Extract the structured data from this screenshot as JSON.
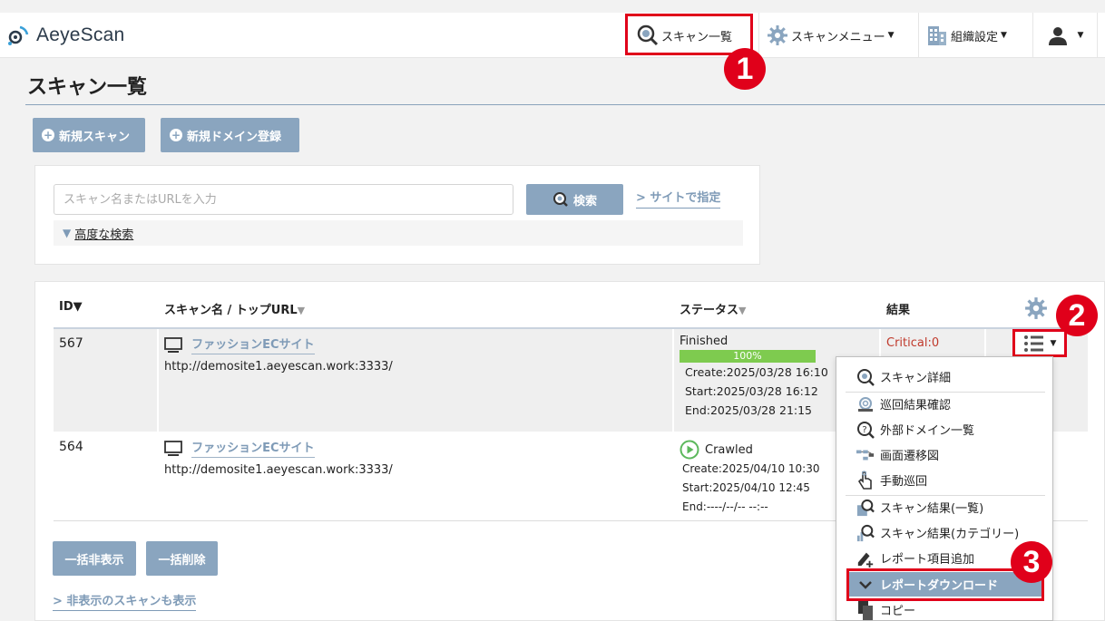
{
  "app": {
    "logo_text": "AeyeScan"
  },
  "nav": {
    "scan_list": "スキャン一覧",
    "scan_menu": "スキャンメニュー",
    "org_settings": "組織設定"
  },
  "markers": {
    "one": "1",
    "two": "2",
    "three": "3"
  },
  "page": {
    "title": "スキャン一覧"
  },
  "actions": {
    "new_scan": "新規スキャン",
    "new_domain": "新規ドメイン登録"
  },
  "search": {
    "placeholder": "スキャン名またはURLを入力",
    "button": "検索",
    "site_link": "サイトで指定",
    "advanced": "高度な検索"
  },
  "table": {
    "headers": {
      "id": "ID▼",
      "name": "スキャン名 / トップURL",
      "status": "ステータス",
      "result": "結果"
    },
    "rows": [
      {
        "id": "567",
        "name": "ファッションECサイト",
        "url": "http://demosite1.aeyescan.work:3333/",
        "status": "Finished",
        "progress_label": "100%",
        "progress": 1.0,
        "create": "Create:2025/03/28 16:10",
        "start": "Start:2025/03/28 16:12",
        "end": "End:2025/03/28 21:15",
        "result": "Critical:0"
      },
      {
        "id": "564",
        "name": "ファッションECサイト",
        "url": "http://demosite1.aeyescan.work:3333/",
        "status": "Crawled",
        "create": "Create:2025/04/10 10:30",
        "start": "Start:2025/04/10 12:45",
        "end": "End:----/--/-- --:--"
      }
    ]
  },
  "bulk": {
    "hide": "一括非表示",
    "delete": "一括削除",
    "show_hidden": "非表示のスキャンも表示"
  },
  "menu": {
    "items": [
      {
        "label": "スキャン詳細",
        "icon": "magnifier-icon"
      },
      {
        "label": "巡回結果確認",
        "icon": "snail-icon"
      },
      {
        "label": "外部ドメイン一覧",
        "icon": "question-magnifier-icon"
      },
      {
        "label": "画面遷移図",
        "icon": "flow-diagram-icon"
      },
      {
        "label": "手動巡回",
        "icon": "hand-pointer-icon"
      },
      {
        "label": "スキャン結果(一覧)",
        "icon": "result-list-icon"
      },
      {
        "label": "スキャン結果(カテゴリー)",
        "icon": "result-category-icon"
      },
      {
        "label": "レポート項目追加",
        "icon": "pen-plus-icon"
      },
      {
        "label": "レポートダウンロード",
        "icon": "chevron-down-icon"
      },
      {
        "label": "コピー",
        "icon": "copy-icon"
      }
    ]
  },
  "colors": {
    "accent": "#8aa5bf",
    "marker": "#e0001a",
    "progress": "#7ecb4f",
    "critical": "#c0392b"
  }
}
